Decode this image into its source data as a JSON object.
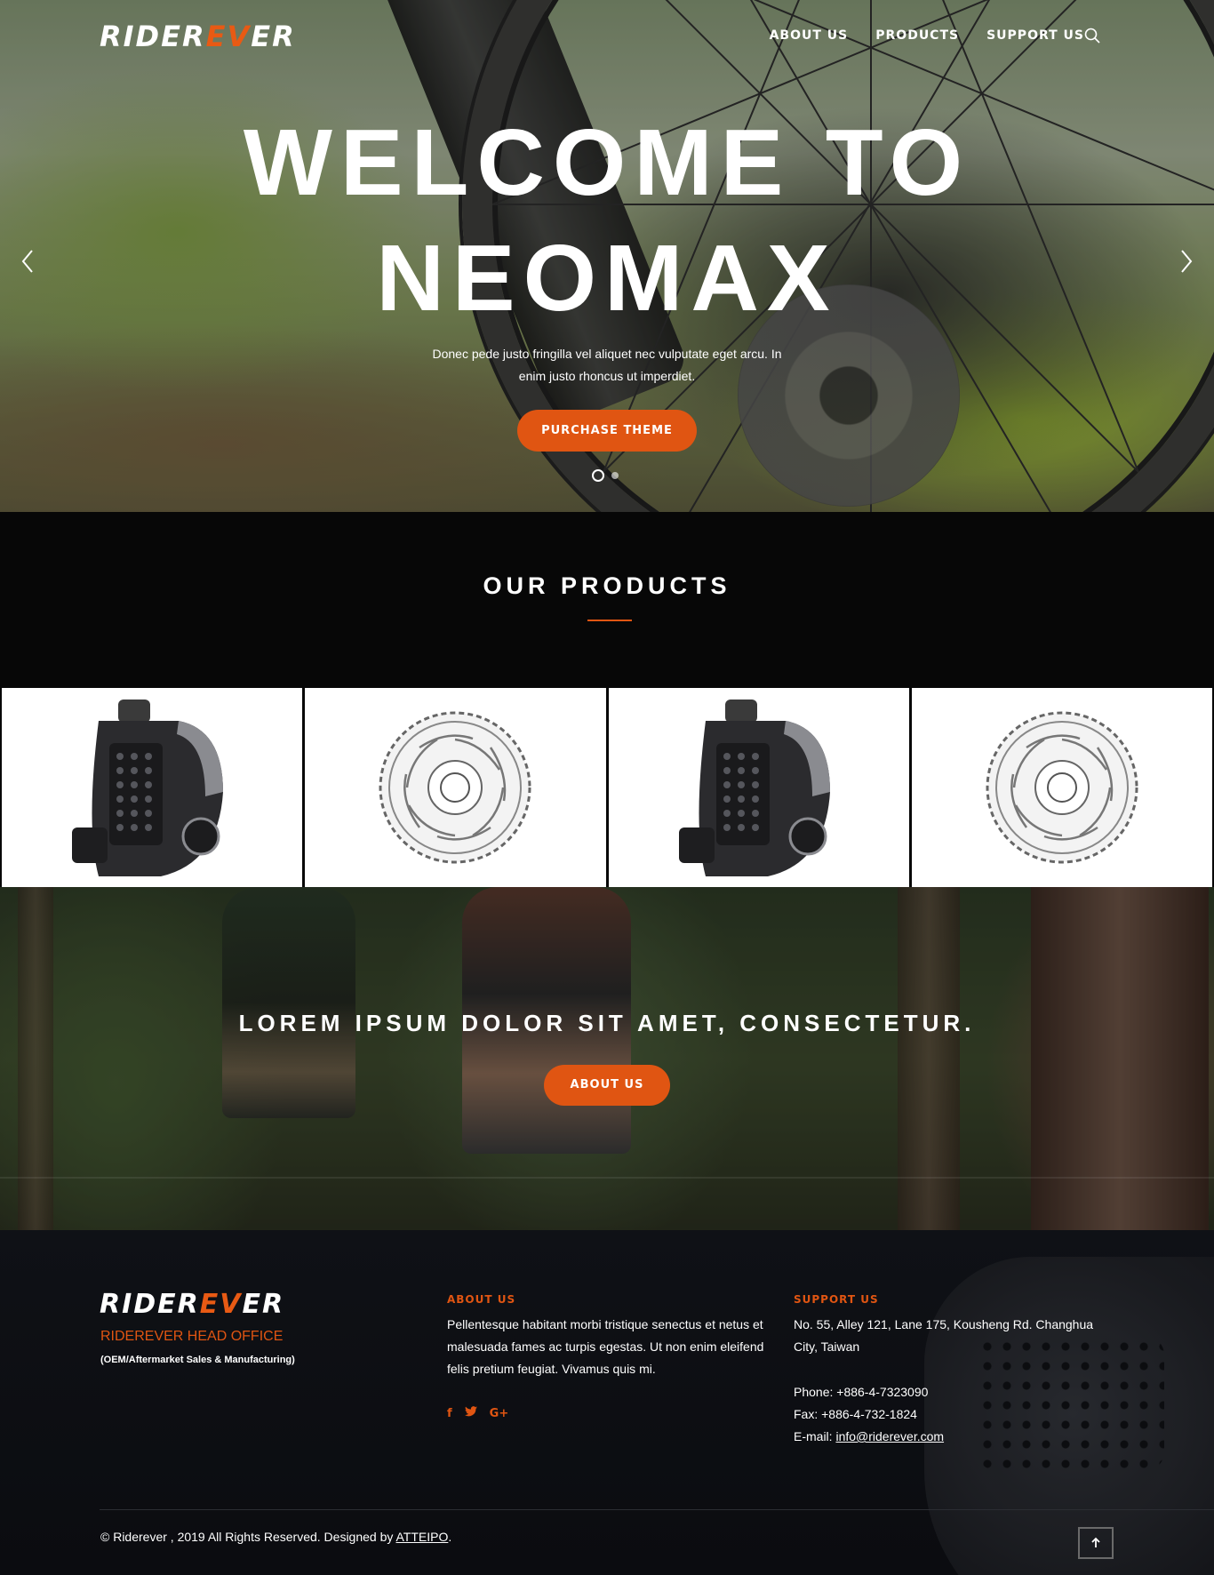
{
  "nav": {
    "logo": {
      "main": "RIDER",
      "accent": "EV",
      "end": "ER"
    },
    "links": [
      "ABOUT US",
      "PRODUCTS",
      "SUPPORT US"
    ],
    "search_icon": "search-icon"
  },
  "hero": {
    "title": "WELCOME TO\nNEOMAX",
    "text": "Donec pede justo fringilla vel aliquet nec vulputate eget arcu. In enim justo rhoncus ut imperdiet.",
    "button": "PURCHASE THEME",
    "slides": 2,
    "active_slide": 1
  },
  "products": {
    "title": "OUR PRODUCTS",
    "items": [
      {
        "name": "brake-caliper"
      },
      {
        "name": "brake-rotor"
      },
      {
        "name": "brake-caliper"
      },
      {
        "name": "brake-rotor"
      }
    ]
  },
  "banner": {
    "title": "LOREM IPSUM DOLOR SIT AMET, CONSECTETUR.",
    "button": "ABOUT US"
  },
  "footer": {
    "office": "RIDEREVER HEAD OFFICE",
    "sub": "(OEM/Aftermarket Sales & Manufacturing)",
    "about": {
      "heading": "ABOUT US",
      "text": "Pellentesque habitant morbi tristique senectus et netus et malesuada fames ac turpis egestas. Ut non enim eleifend felis pretium feugiat. Vivamus quis mi.",
      "social": [
        "f",
        "t",
        "G+"
      ]
    },
    "support": {
      "heading": "SUPPORT US",
      "address": "No. 55, Alley 121, Lane 175, Kousheng Rd. Changhua City, Taiwan",
      "phone": "Phone: +886-4-7323090",
      "fax": "Fax: +886-4-732-1824",
      "email_label": "E-mail: ",
      "email": "info@riderever.com"
    },
    "copyright": "© Riderever , 2019 All Rights Reserved. Designed by ",
    "designer": "ATTEIPO",
    "copyright_end": "."
  },
  "colors": {
    "accent": "#e05512",
    "dark": "#070707",
    "footer": "#0f1116"
  }
}
